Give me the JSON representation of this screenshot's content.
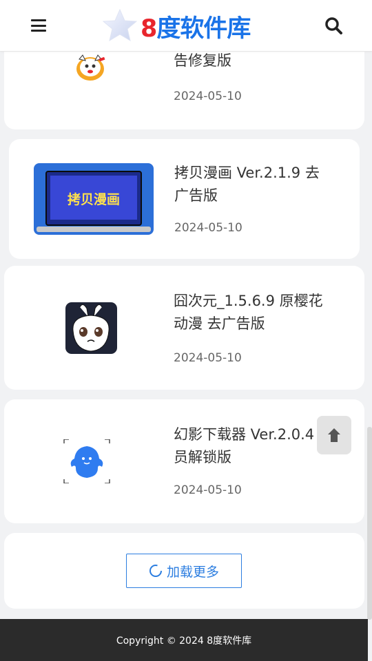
{
  "header": {
    "logo_number": "8",
    "logo_text": "度软件库",
    "menu_icon": "bars-icon",
    "search_icon": "search-icon"
  },
  "items": [
    {
      "title_line1": "",
      "title_line2": "告修复版",
      "date": "2024-05-10",
      "thumb_icon": "cat-avatar-icon"
    },
    {
      "title_line1": "拷贝漫画 Ver.2.1.9 去",
      "title_line2": "广告版",
      "date": "2024-05-10",
      "thumb_text": "拷贝漫画"
    },
    {
      "title_line1": "囧次元_1.5.6.9 原樱花",
      "title_line2": "动漫 去广告版",
      "date": "2024-05-10",
      "thumb_icon": "rabbit-app-icon"
    },
    {
      "title_line1": "幻影下载器 Ver.2.0.4",
      "title_line2": "员解锁版",
      "date": "2024-05-10",
      "thumb_icon": "ghost-app-icon"
    }
  ],
  "load_more": "加载更多",
  "back_to_top_icon": "arrow-up-icon",
  "footer": "Copyright © 2024 8度软件库",
  "colors": {
    "accent": "#2b7de0",
    "logo_red": "#e8262d",
    "logo_blue": "#1a73e8",
    "footer_bg": "#2b2b2b"
  }
}
